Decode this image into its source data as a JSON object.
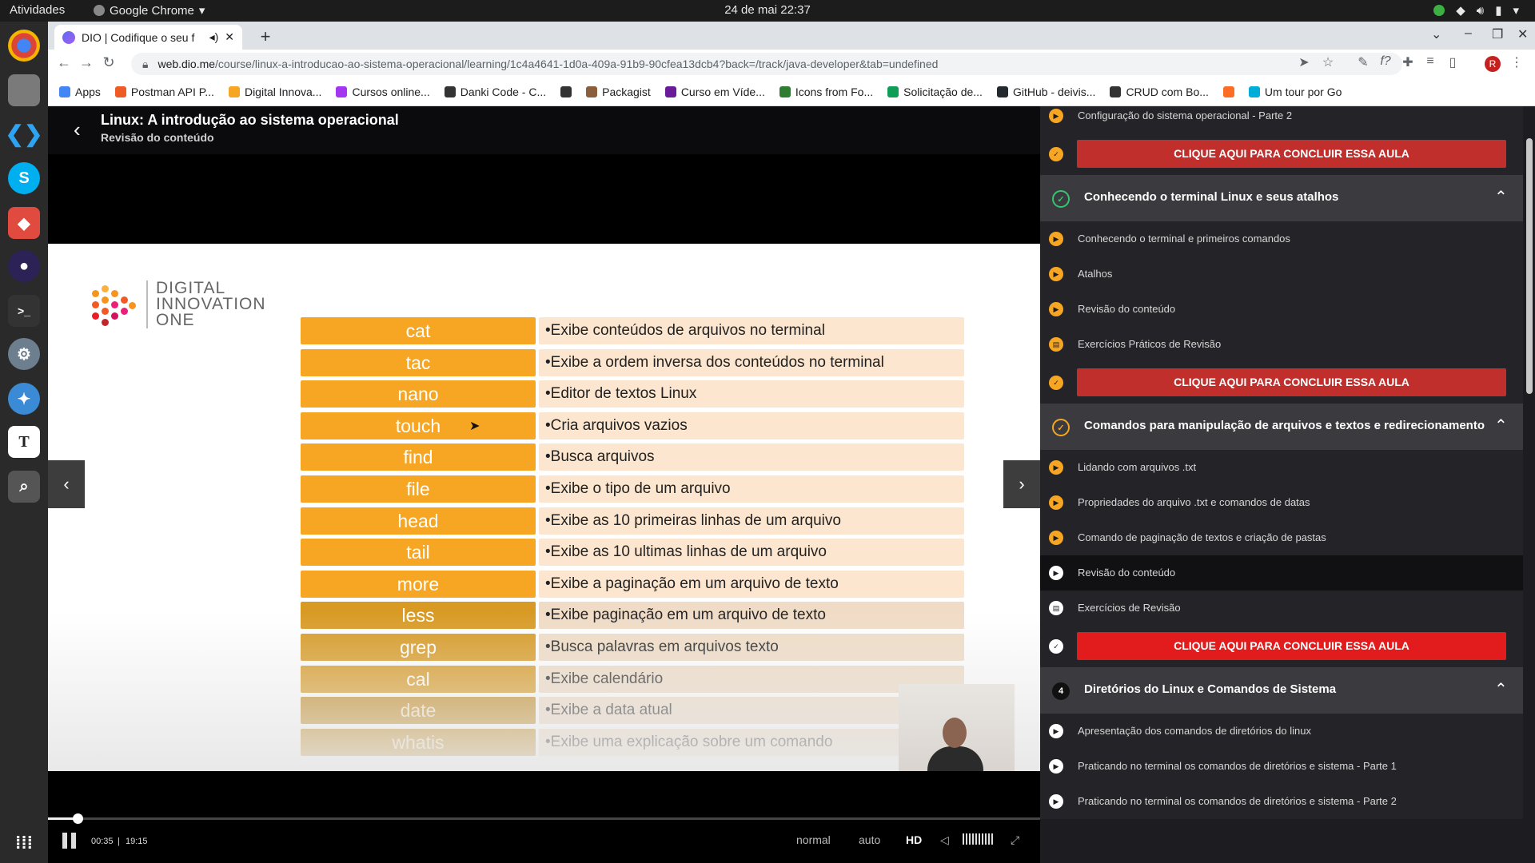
{
  "os": {
    "activities": "Atividades",
    "app_menu": "Google Chrome",
    "clock": "24 de mai  22:37"
  },
  "browser": {
    "tab_title": "DIO | Codifique o seu f",
    "url_host": "web.dio.me",
    "url_path": "/course/linux-a-introducao-ao-sistema-operacional/learning/1c4a4641-1d0a-409a-91b9-90cfea13dcb4?back=/track/java-developer&tab=undefined",
    "avatar_letter": "R",
    "bookmarks": [
      {
        "label": "Apps",
        "color": "#4285f4"
      },
      {
        "label": "Postman API P...",
        "color": "#ef5b25"
      },
      {
        "label": "Digital Innova...",
        "color": "#f6a623"
      },
      {
        "label": "Cursos online...",
        "color": "#a435f0"
      },
      {
        "label": "Danki Code - C...",
        "color": "#333333"
      },
      {
        "label": "",
        "color": "#333333"
      },
      {
        "label": "Packagist",
        "color": "#8b5e3c"
      },
      {
        "label": "Curso em Víde...",
        "color": "#6a1b9a"
      },
      {
        "label": "Icons from Fo...",
        "color": "#2e7d32"
      },
      {
        "label": "Solicitação de...",
        "color": "#0f9d58"
      },
      {
        "label": "GitHub - deivis...",
        "color": "#24292e"
      },
      {
        "label": "CRUD com Bo...",
        "color": "#333333"
      },
      {
        "label": "",
        "color": "#fc6d26"
      },
      {
        "label": "Um tour por Go",
        "color": "#00add8"
      }
    ]
  },
  "course": {
    "title": "Linux: A introdução ao sistema operacional",
    "subtitle": "Revisão do conteúdo"
  },
  "slide": {
    "logo_lines": [
      "DIGITAL",
      "INNOVATION",
      "ONE"
    ],
    "commands": [
      {
        "name": "cat",
        "desc": "•Exibe conteúdos de arquivos no terminal"
      },
      {
        "name": "tac",
        "desc": "•Exibe a ordem inversa dos conteúdos no terminal"
      },
      {
        "name": "nano",
        "desc": "•Editor de textos Linux"
      },
      {
        "name": "touch",
        "desc": "•Cria arquivos vazios"
      },
      {
        "name": "find",
        "desc": "•Busca arquivos"
      },
      {
        "name": "file",
        "desc": "•Exibe o tipo de um arquivo"
      },
      {
        "name": "head",
        "desc": "•Exibe as 10 primeiras linhas de um arquivo"
      },
      {
        "name": "tail",
        "desc": "•Exibe as 10 ultimas linhas de um arquivo"
      },
      {
        "name": "more",
        "desc": "•Exibe a paginação em um arquivo de texto"
      },
      {
        "name": "less",
        "desc": "•Exibe paginação em um arquivo de texto"
      },
      {
        "name": "grep",
        "desc": "•Busca palavras em arquivos texto"
      },
      {
        "name": "cal",
        "desc": "•Exibe calendário"
      },
      {
        "name": "date",
        "desc": "•Exibe a data atual"
      },
      {
        "name": "whatis",
        "desc": "•Exibe uma explicação sobre um comando"
      }
    ]
  },
  "player": {
    "current_time": "00:35",
    "separator": "|",
    "duration": "19:15",
    "progress_fraction": 0.03,
    "speed": "normal",
    "quality_mode": "auto",
    "hd": "HD"
  },
  "sidebar": {
    "concluir_label": "CLIQUE AQUI PARA CONCLUIR ESSA AULA",
    "top_lesson": "Configuração do sistema operacional - Parte 2",
    "modules": [
      {
        "title": "Conhecendo o terminal Linux e seus atalhos",
        "badge": "✓",
        "lessons": [
          "Conhecendo o terminal e primeiros comandos",
          "Atalhos",
          "Revisão do conteúdo",
          "Exercícios Práticos de Revisão"
        ]
      },
      {
        "title": "Comandos para manipulação de arquivos e textos e redirecionamento",
        "badge": "✓",
        "lessons": [
          "Lidando com arquivos .txt",
          "Propriedades do arquivo .txt e comandos de datas",
          "Comando de paginação de textos e criação de pastas",
          "Revisão do conteúdo",
          "Exercícios de Revisão"
        ]
      },
      {
        "title": "Diretórios do Linux e Comandos de Sistema",
        "badge": "4",
        "lessons": [
          "Apresentação dos comandos de diretórios do linux",
          "Praticando no terminal os comandos de diretórios e sistema - Parte 1",
          "Praticando no terminal os comandos de diretórios e sistema - Parte 2"
        ]
      }
    ]
  },
  "colors": {
    "accent": "#f6a623",
    "concluir": "#c12f2c",
    "concluir_active": "#e21c1c"
  }
}
